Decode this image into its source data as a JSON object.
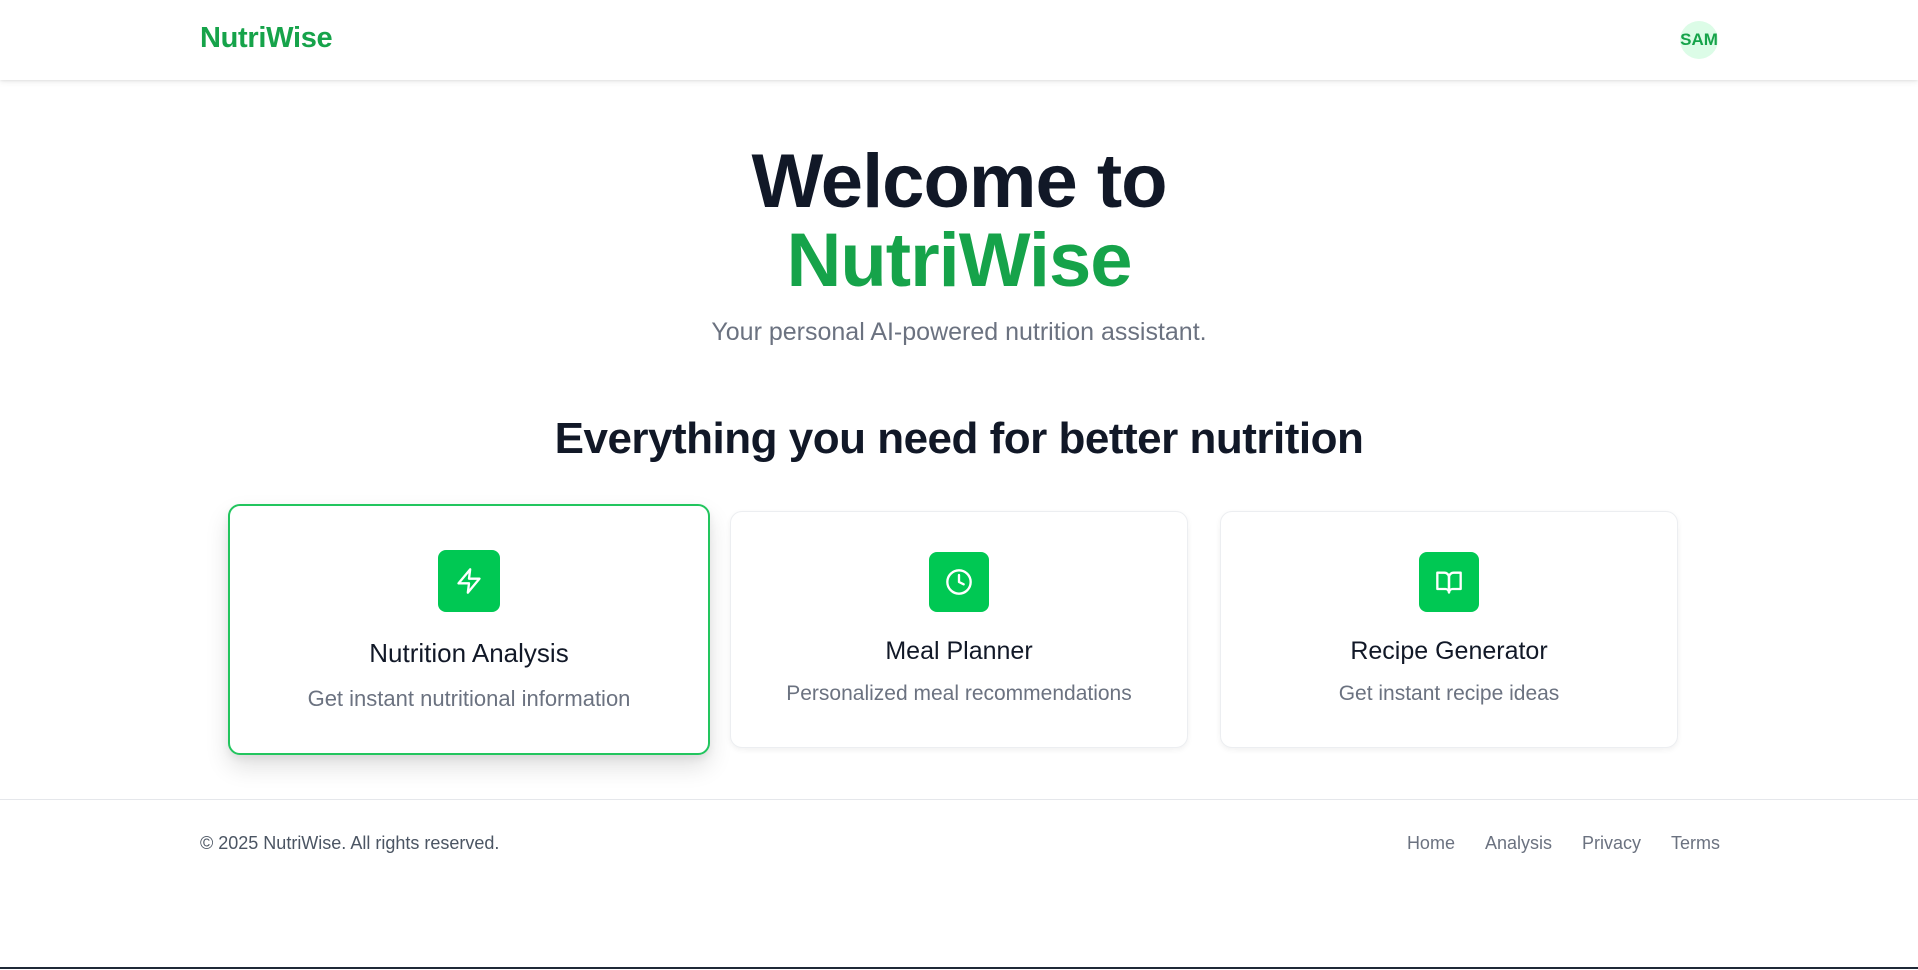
{
  "header": {
    "logo": "NutriWise",
    "avatar_initials": "SAM"
  },
  "hero": {
    "title_line1": "Welcome to",
    "title_line2": "NutriWise",
    "subtitle": "Your personal AI-powered nutrition assistant."
  },
  "features": {
    "heading": "Everything you need for better nutrition",
    "cards": [
      {
        "title": "Nutrition Analysis",
        "description": "Get instant nutritional information",
        "icon": "lightning-icon",
        "active": true
      },
      {
        "title": "Meal Planner",
        "description": "Personalized meal recommendations",
        "icon": "clock-icon",
        "active": false
      },
      {
        "title": "Recipe Generator",
        "description": "Get instant recipe ideas",
        "icon": "book-open-icon",
        "active": false
      }
    ]
  },
  "footer": {
    "copyright": "© 2025 NutriWise. All rights reserved.",
    "links": [
      "Home",
      "Analysis",
      "Privacy",
      "Terms"
    ]
  },
  "colors": {
    "brand_green": "#16a34a",
    "icon_green": "#00c853",
    "active_border": "#22c55e",
    "avatar_bg": "#dcfce7",
    "heading_dark": "#111827",
    "muted_text": "#6b7280"
  }
}
